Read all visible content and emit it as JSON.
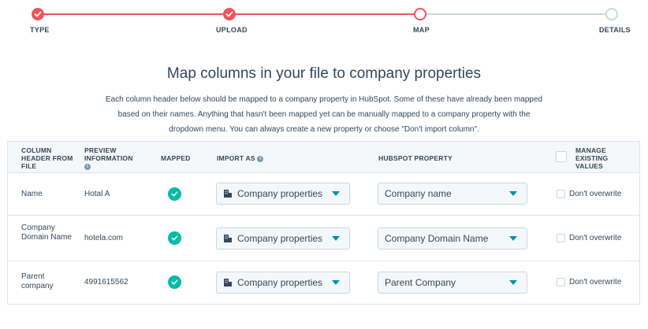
{
  "stepper": {
    "steps": [
      {
        "label": "TYPE",
        "state": "done"
      },
      {
        "label": "UPLOAD",
        "state": "done"
      },
      {
        "label": "MAP",
        "state": "current"
      },
      {
        "label": "DETAILS",
        "state": "future"
      }
    ]
  },
  "heading": {
    "title": "Map columns in your file to company properties",
    "description": "Each column header below should be mapped to a company property in HubSpot. Some of these have already been mapped based on their names. Anything that hasn't been mapped yet can be manually mapped to a company property with the dropdown menu. You can always create a new property or choose \"Don't import column\"."
  },
  "table": {
    "headers": {
      "column_header": "COLUMN HEADER FROM FILE",
      "preview": "PREVIEW INFORMATION",
      "mapped": "MAPPED",
      "import_as": "IMPORT AS",
      "property": "HUBSPOT PROPERTY",
      "manage": "MANAGE EXISTING VALUES"
    },
    "rows": [
      {
        "column": "Name",
        "preview": "Hotal A",
        "import_as": "Company properties",
        "property": "Company name",
        "overwrite": "Don't overwrite"
      },
      {
        "column": "Company Domain Name",
        "preview": "hotela.com",
        "import_as": "Company properties",
        "property": "Company Domain Name",
        "overwrite": "Don't overwrite"
      },
      {
        "column": "Parent company",
        "preview": "4991615562",
        "import_as": "Company properties",
        "property": "Parent Company",
        "overwrite": "Don't overwrite"
      }
    ]
  },
  "icons": {
    "step_done": "check-icon",
    "mapped": "check-circle-icon",
    "import_as": "building-icon",
    "info": "info-icon",
    "dropdown": "caret-down-icon"
  },
  "colors": {
    "accent": "#f2545b",
    "mapped": "#00bda5",
    "caret": "#0091ae",
    "text": "#33475b",
    "line_inactive": "#cbd6e2"
  }
}
